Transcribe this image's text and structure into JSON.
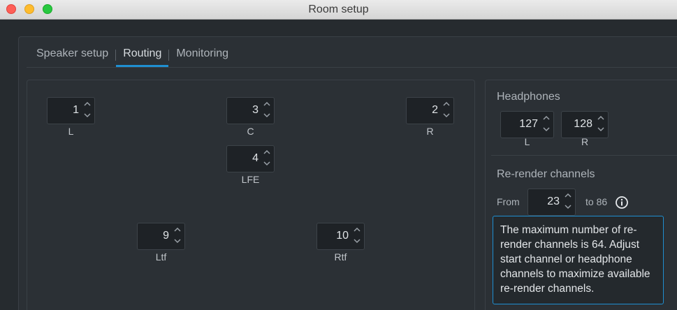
{
  "window": {
    "title": "Room setup"
  },
  "tabs": [
    {
      "label": "Speaker setup"
    },
    {
      "label": "Routing"
    },
    {
      "label": "Monitoring"
    }
  ],
  "speakers": {
    "L": {
      "label": "L",
      "value": "1"
    },
    "C": {
      "label": "C",
      "value": "3"
    },
    "R": {
      "label": "R",
      "value": "2"
    },
    "LFE": {
      "label": "LFE",
      "value": "4"
    },
    "Ltf": {
      "label": "Ltf",
      "value": "9"
    },
    "Rtf": {
      "label": "Rtf",
      "value": "10"
    }
  },
  "headphones": {
    "title": "Headphones",
    "left": {
      "label": "L",
      "value": "127"
    },
    "right": {
      "label": "R",
      "value": "128"
    }
  },
  "rerender": {
    "title": "Re-render channels",
    "from_label": "From",
    "from_value": "23",
    "to_text": "to 86",
    "info_message": "The maximum number of re-render channels is 64. Adjust start channel or headphone channels to maximize available re-render channels."
  },
  "colors": {
    "accent": "#1f8fd1",
    "background": "#2b3035",
    "field": "#1e2226"
  },
  "icons": {
    "info": "info-circle-icon",
    "spin_up": "chevron-up-icon",
    "spin_down": "chevron-down-icon"
  }
}
